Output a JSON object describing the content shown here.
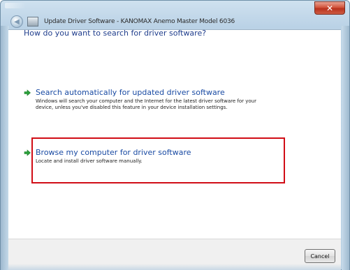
{
  "window": {
    "title": "Update Driver Software - KANOMAX Anemo Master Model 6036",
    "close_label": "✕"
  },
  "dialog": {
    "heading": "How do you want to search for driver software?"
  },
  "options": [
    {
      "title": "Search automatically for updated driver software",
      "description": "Windows will search your computer and the Internet for the latest driver software for your device, unless you've disabled this feature in your device installation settings."
    },
    {
      "title": "Browse my computer for driver software",
      "description": "Locate and install driver software manually."
    }
  ],
  "footer": {
    "cancel_label": "Cancel"
  },
  "colors": {
    "link": "#1a4ba3",
    "heading": "#1f3d8c",
    "arrow": "#2aa13a",
    "highlight_box": "#d10d16"
  },
  "icons": {
    "back": "back-arrow-icon",
    "device": "device-icon",
    "option_arrow": "green-arrow-icon",
    "close": "close-icon"
  }
}
